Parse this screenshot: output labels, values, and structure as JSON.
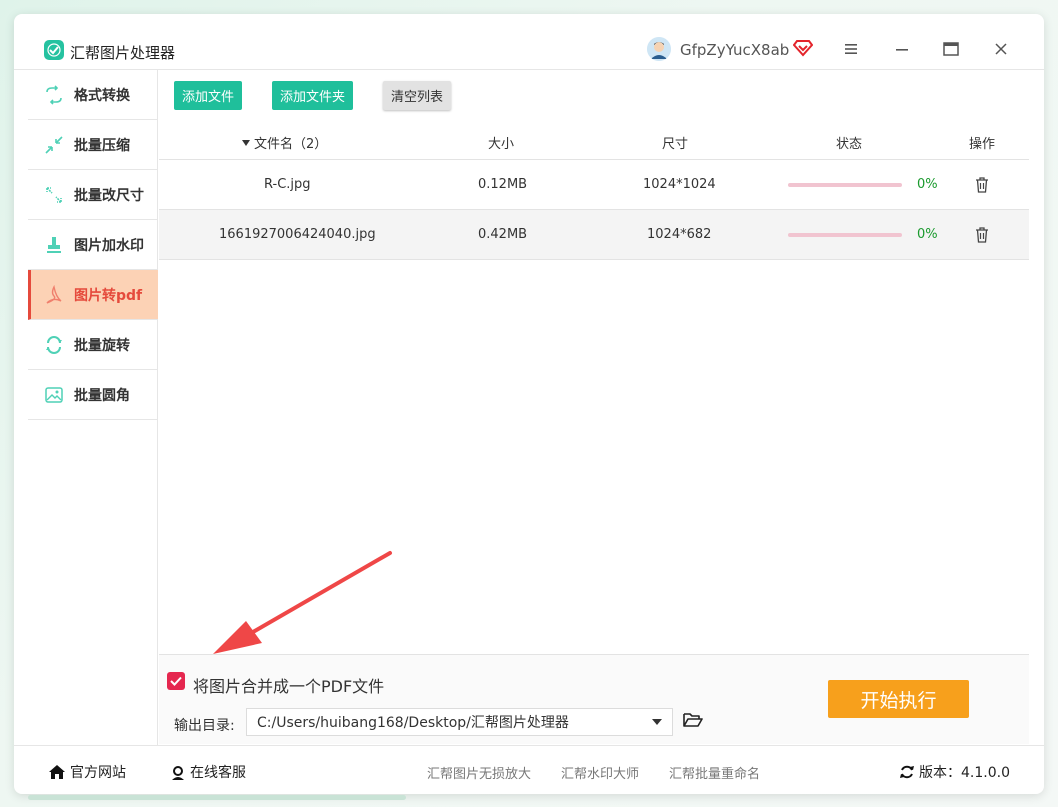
{
  "app": {
    "title": "汇帮图片处理器",
    "username": "GfpZyYucX8ab"
  },
  "sidebar": {
    "items": [
      {
        "label": "格式转换",
        "icon": "format-convert-icon"
      },
      {
        "label": "批量压缩",
        "icon": "compress-icon"
      },
      {
        "label": "批量改尺寸",
        "icon": "resize-icon"
      },
      {
        "label": "图片加水印",
        "icon": "watermark-icon"
      },
      {
        "label": "图片转pdf",
        "icon": "pdf-icon",
        "active": true
      },
      {
        "label": "批量旋转",
        "icon": "rotate-icon"
      },
      {
        "label": "批量圆角",
        "icon": "rounded-corner-icon"
      }
    ]
  },
  "toolbar": {
    "add_file": "添加文件",
    "add_folder": "添加文件夹",
    "clear_list": "清空列表"
  },
  "table": {
    "headers": {
      "name": "文件名（2）",
      "size": "大小",
      "dimensions": "尺寸",
      "status": "状态",
      "action": "操作"
    },
    "rows": [
      {
        "name": "R-C.jpg",
        "size": "0.12MB",
        "dimensions": "1024*1024",
        "progress": 0,
        "status": "0%"
      },
      {
        "name": "1661927006424040.jpg",
        "size": "0.42MB",
        "dimensions": "1024*682",
        "progress": 0,
        "status": "0%"
      }
    ]
  },
  "options": {
    "merge_label": "将图片合并成一个PDF文件",
    "merge_checked": true,
    "output_label": "输出目录:",
    "output_path": "C:/Users/huibang168/Desktop/汇帮图片处理器",
    "start_button": "开始执行"
  },
  "footer": {
    "website": "官方网站",
    "support": "在线客服",
    "links": [
      "汇帮图片无损放大",
      "汇帮水印大师",
      "汇帮批量重命名"
    ],
    "version_label": "版本：4.1.0.0"
  },
  "colors": {
    "accent_green": "#1fbf9b",
    "active_red": "#e54a3c",
    "active_bg": "#fcd2b5",
    "start_orange": "#f7a01c",
    "checkbox_red": "#e5274f",
    "progress_text_green": "#1a9a2e",
    "progress_track_pink": "#f1c4d0"
  }
}
